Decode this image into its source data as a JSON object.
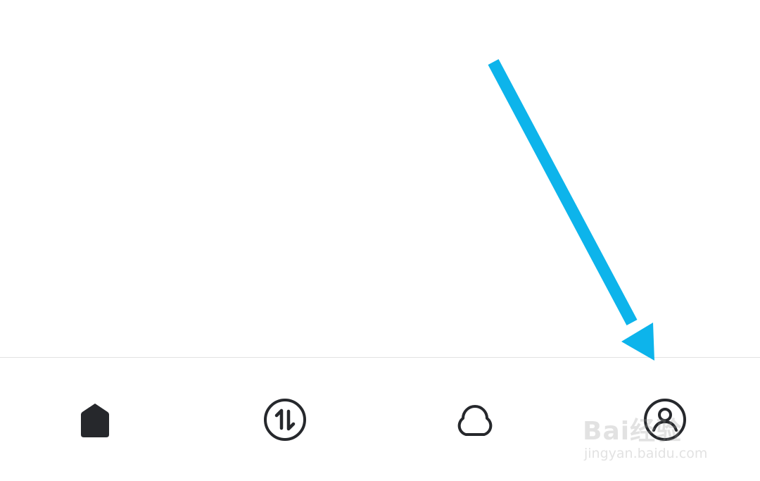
{
  "tab_bar": {
    "tabs": [
      {
        "name": "home",
        "icon": "home-icon",
        "active": true
      },
      {
        "name": "transfer",
        "icon": "transfer-arrows-icon",
        "active": false
      },
      {
        "name": "cloud",
        "icon": "cloud-icon",
        "active": false
      },
      {
        "name": "profile",
        "icon": "user-circle-icon",
        "active": false
      }
    ]
  },
  "annotation": {
    "type": "arrow",
    "target": "profile-tab",
    "color": "#0DB4EB"
  },
  "watermark": {
    "brand": "Bai经验",
    "url": "jingyan.baidu.com"
  },
  "colors": {
    "icon": "#26282c",
    "divider": "#e2e2e2",
    "background": "#ffffff"
  }
}
